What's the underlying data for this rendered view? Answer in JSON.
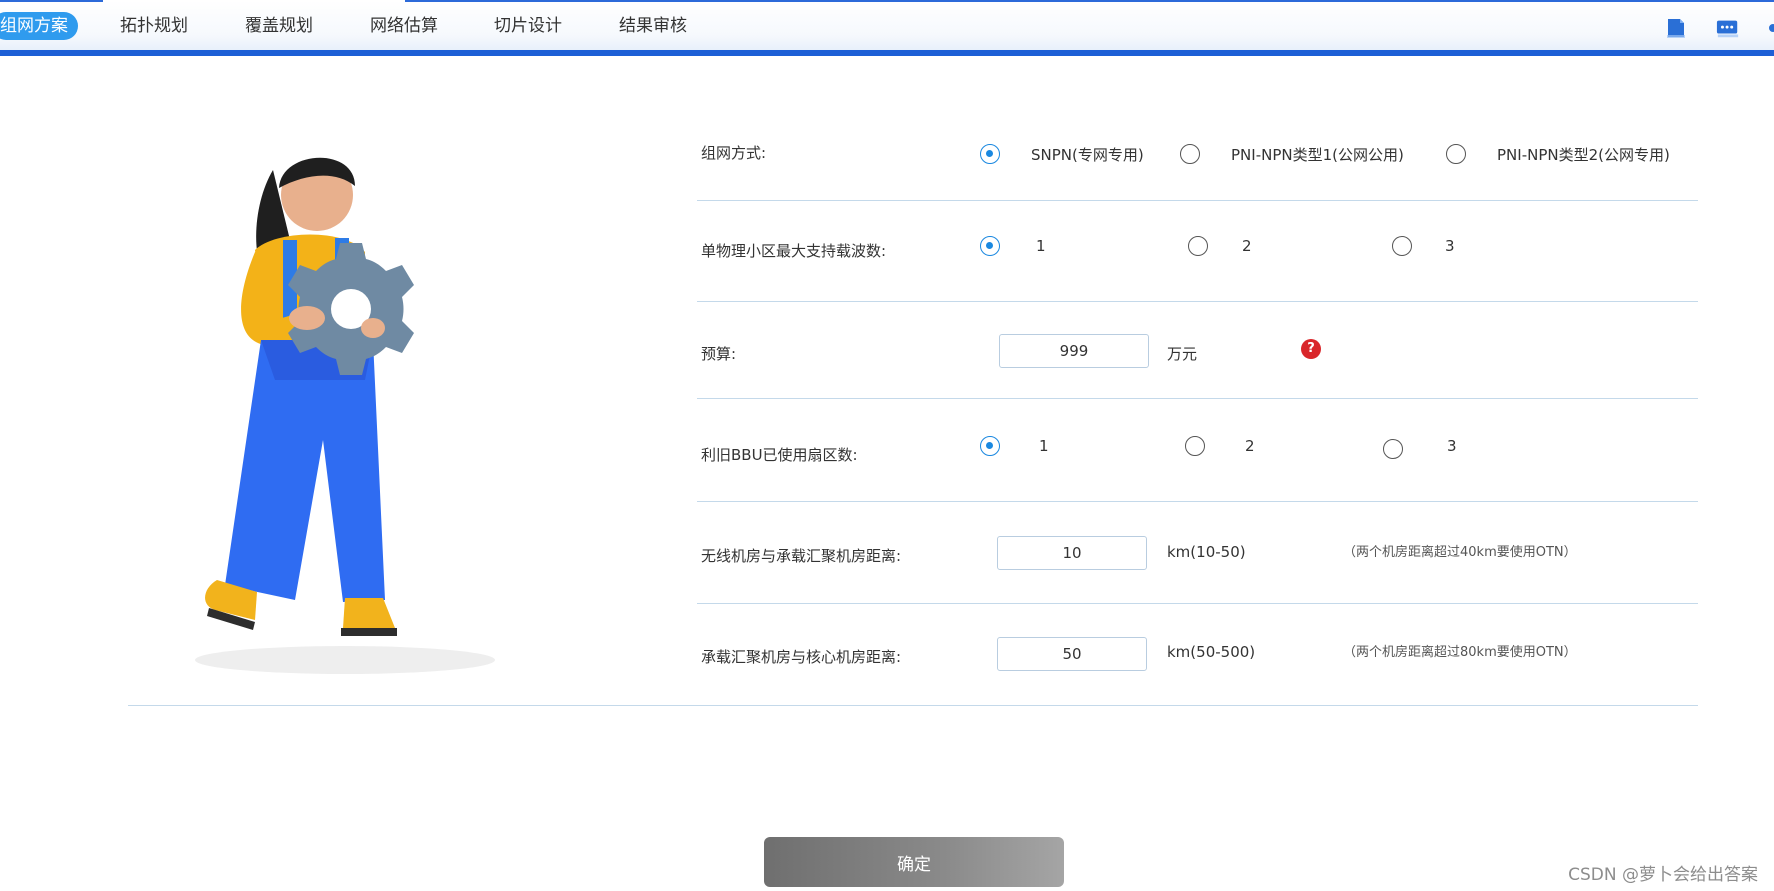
{
  "nav": {
    "tabs": [
      {
        "label": "组网方案",
        "active": true
      },
      {
        "label": "拓扑规划"
      },
      {
        "label": "覆盖规划"
      },
      {
        "label": "网络估算"
      },
      {
        "label": "切片设计"
      },
      {
        "label": "结果审核"
      }
    ],
    "icons": [
      "document-icon",
      "chat-icon",
      "more-icon"
    ],
    "active_color": "#2f9bee",
    "accent_color": "#1d5fd6"
  },
  "form": {
    "networking_mode": {
      "label": "组网方式:",
      "options": [
        "SNPN(专网专用)",
        "PNI-NPN类型1(公网公用)",
        "PNI-NPN类型2(公网专用)"
      ],
      "selected": "SNPN(专网专用)"
    },
    "max_carriers": {
      "label": "单物理小区最大支持载波数:",
      "options": [
        "1",
        "2",
        "3"
      ],
      "selected": "1"
    },
    "budget": {
      "label": "预算:",
      "value": "999",
      "unit": "万元",
      "help_icon": "?"
    },
    "reuse_bbu_sectors": {
      "label": "利旧BBU已使用扇区数:",
      "options": [
        "1",
        "2",
        "3"
      ],
      "selected": "1"
    },
    "wireless_to_aggregation": {
      "label": "无线机房与承载汇聚机房距离:",
      "value": "10",
      "unit": "km(10-50)",
      "hint": "（两个机房距离超过40km要使用OTN）"
    },
    "aggregation_to_core": {
      "label": "承载汇聚机房与核心机房距离:",
      "value": "50",
      "unit": "km(50-500)",
      "hint": "（两个机房距离超过80km要使用OTN）"
    }
  },
  "confirm_label": "确定",
  "watermark": "CSDN @萝卜会给出答案"
}
